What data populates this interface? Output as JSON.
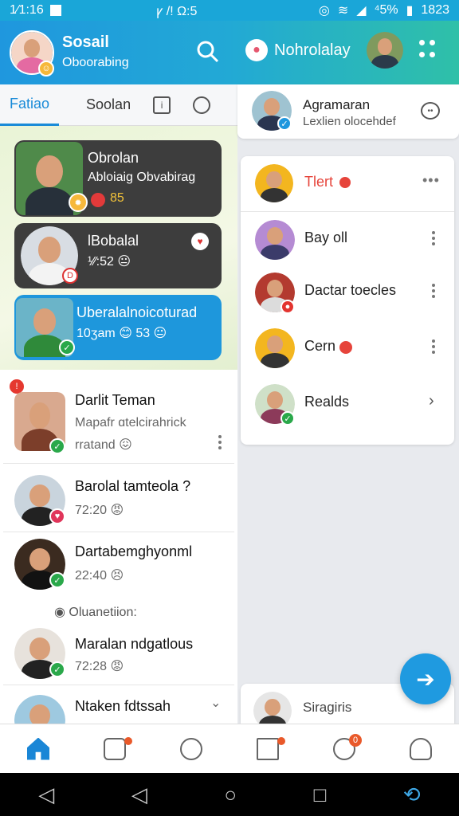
{
  "status_bar": {
    "time_left": "1⁄1:16",
    "mid": "ꝩ /! Ω:5",
    "battery": "⁴5%",
    "time_right": "1823"
  },
  "header": {
    "app_title": "Sosail",
    "app_subtitle": "Oboorabing",
    "right_title": "Nohrolalay",
    "accent": "#1f97de"
  },
  "tabs": [
    {
      "label": "Fatiao",
      "active": true
    },
    {
      "label": "Soolan",
      "active": false
    }
  ],
  "stories": [
    {
      "title": "Obrolan",
      "subtitle": "Abloiaig Obvabirag",
      "meta": "85",
      "color": "#3d3d3d"
    },
    {
      "title": "lBobalal",
      "subtitle": "",
      "meta": "¹⁄⁄:52 😐",
      "color": "#3d3d3d"
    },
    {
      "title": "Uberalalnoicoturad",
      "subtitle": "",
      "meta": "10ӡam 😊 53 😐",
      "color": "#1e97dc"
    }
  ],
  "chats": [
    {
      "name": "Darlit Teman",
      "sub": "Mapafr ɑtelcirahrick",
      "time": "rratand 😖"
    },
    {
      "name": "Barolal tamteola ?",
      "sub": "",
      "time": "72:20 😡"
    },
    {
      "name": "Dartabemghyonml",
      "sub": "",
      "time": "22:40 😣"
    },
    {
      "name": "Maralan ndgatlous",
      "sub": "",
      "time": "72:28 😡"
    },
    {
      "name": "Ntaken fdtssah",
      "sub": "",
      "time": ""
    }
  ],
  "section_label": "Oluanetiion:",
  "right_top": {
    "name": "Agramaran",
    "sub": "Lexlien olocehdef"
  },
  "right_list": [
    {
      "name": "Tlert",
      "color": "#e6443b"
    },
    {
      "name": "Bay oll",
      "color": "#222"
    },
    {
      "name": "Dactar toecles",
      "color": "#222"
    },
    {
      "name": "Cern",
      "color": "#222"
    },
    {
      "name": "Realds",
      "color": "#222"
    }
  ],
  "right_bottom": {
    "name": "Siragiris"
  }
}
